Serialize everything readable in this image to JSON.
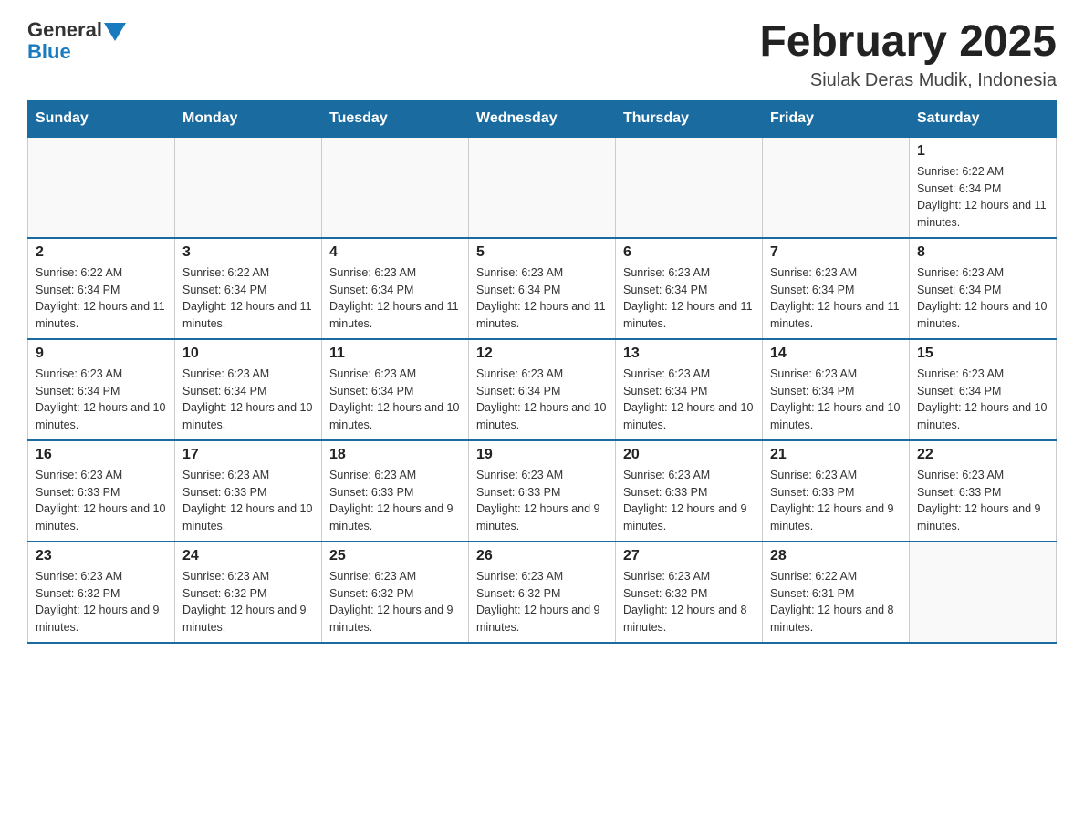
{
  "header": {
    "logo_general": "General",
    "logo_blue": "Blue",
    "month_title": "February 2025",
    "location": "Siulak Deras Mudik, Indonesia"
  },
  "days_of_week": [
    "Sunday",
    "Monday",
    "Tuesday",
    "Wednesday",
    "Thursday",
    "Friday",
    "Saturday"
  ],
  "weeks": [
    [
      {
        "day": "",
        "info": ""
      },
      {
        "day": "",
        "info": ""
      },
      {
        "day": "",
        "info": ""
      },
      {
        "day": "",
        "info": ""
      },
      {
        "day": "",
        "info": ""
      },
      {
        "day": "",
        "info": ""
      },
      {
        "day": "1",
        "info": "Sunrise: 6:22 AM\nSunset: 6:34 PM\nDaylight: 12 hours and 11 minutes."
      }
    ],
    [
      {
        "day": "2",
        "info": "Sunrise: 6:22 AM\nSunset: 6:34 PM\nDaylight: 12 hours and 11 minutes."
      },
      {
        "day": "3",
        "info": "Sunrise: 6:22 AM\nSunset: 6:34 PM\nDaylight: 12 hours and 11 minutes."
      },
      {
        "day": "4",
        "info": "Sunrise: 6:23 AM\nSunset: 6:34 PM\nDaylight: 12 hours and 11 minutes."
      },
      {
        "day": "5",
        "info": "Sunrise: 6:23 AM\nSunset: 6:34 PM\nDaylight: 12 hours and 11 minutes."
      },
      {
        "day": "6",
        "info": "Sunrise: 6:23 AM\nSunset: 6:34 PM\nDaylight: 12 hours and 11 minutes."
      },
      {
        "day": "7",
        "info": "Sunrise: 6:23 AM\nSunset: 6:34 PM\nDaylight: 12 hours and 11 minutes."
      },
      {
        "day": "8",
        "info": "Sunrise: 6:23 AM\nSunset: 6:34 PM\nDaylight: 12 hours and 10 minutes."
      }
    ],
    [
      {
        "day": "9",
        "info": "Sunrise: 6:23 AM\nSunset: 6:34 PM\nDaylight: 12 hours and 10 minutes."
      },
      {
        "day": "10",
        "info": "Sunrise: 6:23 AM\nSunset: 6:34 PM\nDaylight: 12 hours and 10 minutes."
      },
      {
        "day": "11",
        "info": "Sunrise: 6:23 AM\nSunset: 6:34 PM\nDaylight: 12 hours and 10 minutes."
      },
      {
        "day": "12",
        "info": "Sunrise: 6:23 AM\nSunset: 6:34 PM\nDaylight: 12 hours and 10 minutes."
      },
      {
        "day": "13",
        "info": "Sunrise: 6:23 AM\nSunset: 6:34 PM\nDaylight: 12 hours and 10 minutes."
      },
      {
        "day": "14",
        "info": "Sunrise: 6:23 AM\nSunset: 6:34 PM\nDaylight: 12 hours and 10 minutes."
      },
      {
        "day": "15",
        "info": "Sunrise: 6:23 AM\nSunset: 6:34 PM\nDaylight: 12 hours and 10 minutes."
      }
    ],
    [
      {
        "day": "16",
        "info": "Sunrise: 6:23 AM\nSunset: 6:33 PM\nDaylight: 12 hours and 10 minutes."
      },
      {
        "day": "17",
        "info": "Sunrise: 6:23 AM\nSunset: 6:33 PM\nDaylight: 12 hours and 10 minutes."
      },
      {
        "day": "18",
        "info": "Sunrise: 6:23 AM\nSunset: 6:33 PM\nDaylight: 12 hours and 9 minutes."
      },
      {
        "day": "19",
        "info": "Sunrise: 6:23 AM\nSunset: 6:33 PM\nDaylight: 12 hours and 9 minutes."
      },
      {
        "day": "20",
        "info": "Sunrise: 6:23 AM\nSunset: 6:33 PM\nDaylight: 12 hours and 9 minutes."
      },
      {
        "day": "21",
        "info": "Sunrise: 6:23 AM\nSunset: 6:33 PM\nDaylight: 12 hours and 9 minutes."
      },
      {
        "day": "22",
        "info": "Sunrise: 6:23 AM\nSunset: 6:33 PM\nDaylight: 12 hours and 9 minutes."
      }
    ],
    [
      {
        "day": "23",
        "info": "Sunrise: 6:23 AM\nSunset: 6:32 PM\nDaylight: 12 hours and 9 minutes."
      },
      {
        "day": "24",
        "info": "Sunrise: 6:23 AM\nSunset: 6:32 PM\nDaylight: 12 hours and 9 minutes."
      },
      {
        "day": "25",
        "info": "Sunrise: 6:23 AM\nSunset: 6:32 PM\nDaylight: 12 hours and 9 minutes."
      },
      {
        "day": "26",
        "info": "Sunrise: 6:23 AM\nSunset: 6:32 PM\nDaylight: 12 hours and 9 minutes."
      },
      {
        "day": "27",
        "info": "Sunrise: 6:23 AM\nSunset: 6:32 PM\nDaylight: 12 hours and 8 minutes."
      },
      {
        "day": "28",
        "info": "Sunrise: 6:22 AM\nSunset: 6:31 PM\nDaylight: 12 hours and 8 minutes."
      },
      {
        "day": "",
        "info": ""
      }
    ]
  ]
}
